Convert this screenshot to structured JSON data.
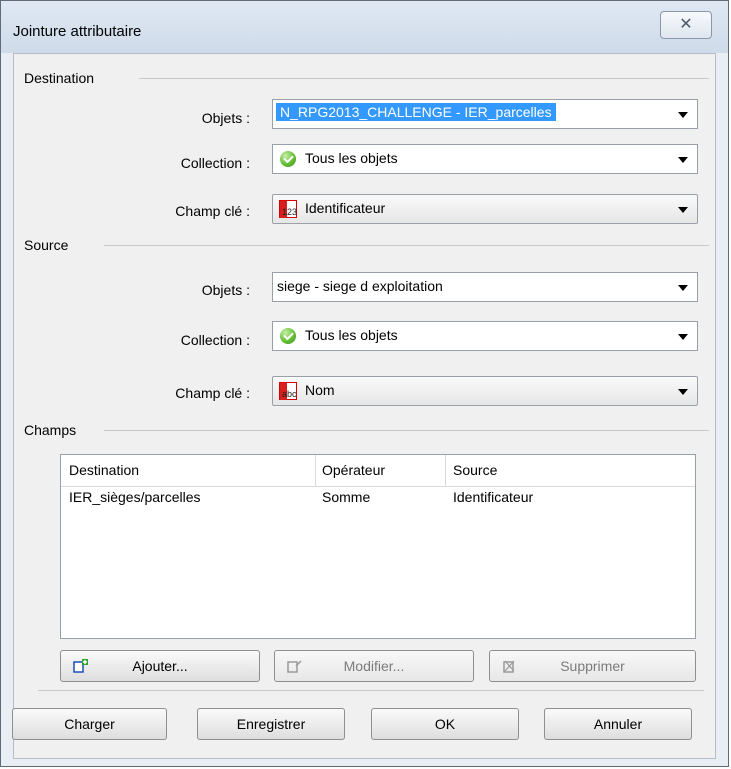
{
  "window": {
    "title": "Jointure attributaire",
    "close_icon": "close-icon"
  },
  "destination": {
    "label": "Destination",
    "objets_label": "Objets :",
    "objets_value": "N_RPG2013_CHALLENGE - IER_parcelles",
    "collection_label": "Collection :",
    "collection_value": "Tous les objets",
    "champ_label": "Champ clé :",
    "champ_value": "Identificateur",
    "champ_type": "123"
  },
  "source": {
    "label": "Source",
    "objets_label": "Objets :",
    "objets_value": "siege - siege d exploitation",
    "collection_label": "Collection :",
    "collection_value": "Tous les objets",
    "champ_label": "Champ clé :",
    "champ_value": "Nom",
    "champ_type": "abc"
  },
  "champs": {
    "label": "Champs",
    "columns": [
      "Destination",
      "Opérateur",
      "Source"
    ],
    "rows": [
      [
        "IER_sièges/parcelles",
        "Somme",
        "Identificateur"
      ]
    ]
  },
  "actions": {
    "ajouter": "Ajouter...",
    "modifier": "Modifier...",
    "supprimer": "Supprimer"
  },
  "footer": {
    "charger": "Charger",
    "enregistrer": "Enregistrer",
    "ok": "OK",
    "annuler": "Annuler"
  }
}
